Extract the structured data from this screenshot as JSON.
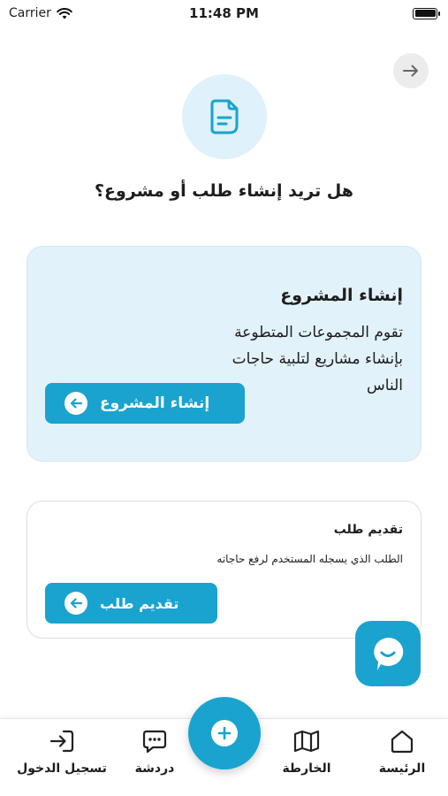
{
  "status_bar": {
    "carrier": "Carrier",
    "time": "11:48 PM"
  },
  "page": {
    "title": "هل تريد إنشاء طلب أو مشروع؟"
  },
  "cards": {
    "project": {
      "title": "إنشاء المشروع",
      "description": "تقوم المجموعات المتطوعة بإنشاء مشاريع لتلبية حاجات الناس",
      "button_label": "إنشاء المشروع"
    },
    "request": {
      "title": "تقديم طلب",
      "description": "الطلب الذي يسجله المستخدم لرفع حاجاته",
      "button_label": "تقديم طلب"
    }
  },
  "bottom_nav": {
    "home": "الرئيسة",
    "map": "الخارطة",
    "chat": "دردشة",
    "login": "تسجيل الدخول"
  },
  "colors": {
    "accent": "#1aa3cf",
    "card_bg": "#e1f2fb",
    "hero_bg": "#dff1fb"
  },
  "icons": {
    "back": "arrow-right-icon",
    "hero": "document-icon",
    "button": "arrow-left-circle-icon",
    "chat_fab": "chat-bubble-smile-icon",
    "home": "home-icon",
    "map": "map-icon",
    "chat": "message-dots-icon",
    "login": "login-icon",
    "add": "plus-icon"
  }
}
